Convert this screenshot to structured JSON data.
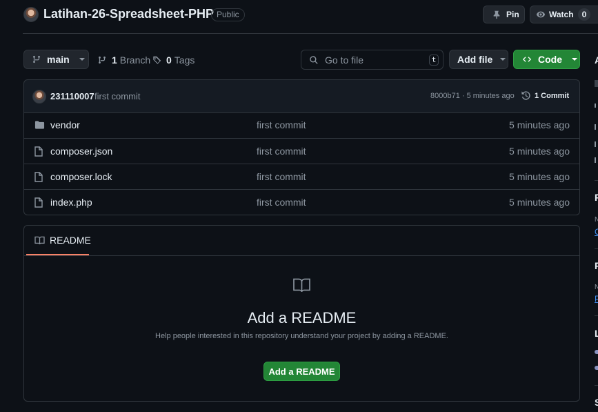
{
  "header": {
    "repo_name": "Latihan-26-Spreadsheet-PHP",
    "visibility": "Public",
    "pin_label": "Pin",
    "watch_label": "Watch",
    "watch_count": "0"
  },
  "toolbar": {
    "branch": "main",
    "branch_count": "1",
    "branch_label": "Branch",
    "tag_count": "0",
    "tag_label": "Tags",
    "search_placeholder": "Go to file",
    "search_shortcut": "t",
    "add_file_label": "Add file",
    "code_label": "Code"
  },
  "latest_commit": {
    "author": "231110007",
    "message": "first commit",
    "hash_time": "8000b71 · 5 minutes ago",
    "commit_count_label": "1 Commit"
  },
  "files": [
    {
      "name": "vendor",
      "type": "folder",
      "message": "first commit",
      "time": "5 minutes ago"
    },
    {
      "name": "composer.json",
      "type": "file",
      "message": "first commit",
      "time": "5 minutes ago"
    },
    {
      "name": "composer.lock",
      "type": "file",
      "message": "first commit",
      "time": "5 minutes ago"
    },
    {
      "name": "index.php",
      "type": "file",
      "message": "first commit",
      "time": "5 minutes ago"
    }
  ],
  "readme": {
    "tab_label": "README",
    "title": "Add a README",
    "subtitle": "Help people interested in this repository understand your project by adding a README.",
    "button_label": "Add a README"
  },
  "sidebar_fragments": {
    "h1": "A",
    "h2": "R",
    "h3": "P",
    "h4": "L",
    "h5": "S",
    "sm1": "N",
    "sm2": "N",
    "link1": "C",
    "link2": "P"
  },
  "colors": {
    "background": "#0d1117",
    "border": "#30363d",
    "green_button": "#238636",
    "accent_underline": "#f78166",
    "muted_text": "#8d96a0"
  }
}
